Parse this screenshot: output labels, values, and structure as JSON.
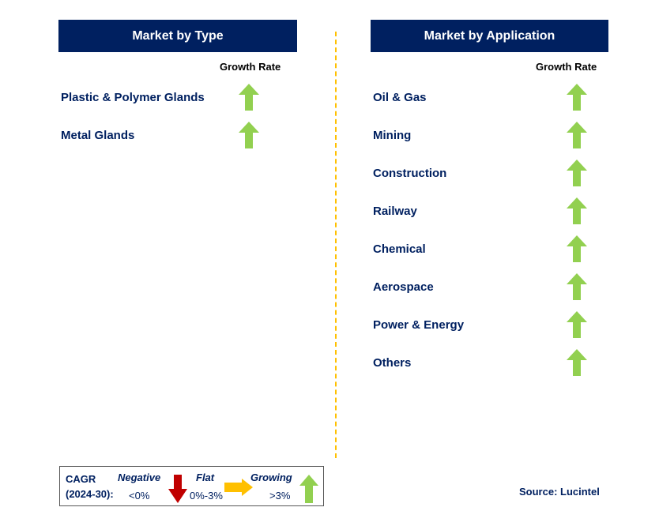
{
  "left": {
    "title": "Market by Type",
    "growth_label": "Growth Rate",
    "items": [
      {
        "label": "Plastic & Polymer Glands",
        "trend": "growing"
      },
      {
        "label": "Metal Glands",
        "trend": "growing"
      }
    ]
  },
  "right": {
    "title": "Market by Application",
    "growth_label": "Growth Rate",
    "items": [
      {
        "label": "Oil & Gas",
        "trend": "growing"
      },
      {
        "label": "Mining",
        "trend": "growing"
      },
      {
        "label": "Construction",
        "trend": "growing"
      },
      {
        "label": "Railway",
        "trend": "growing"
      },
      {
        "label": "Chemical",
        "trend": "growing"
      },
      {
        "label": "Aerospace",
        "trend": "growing"
      },
      {
        "label": "Power & Energy",
        "trend": "growing"
      },
      {
        "label": "Others",
        "trend": "growing"
      }
    ]
  },
  "legend": {
    "cagr": "CAGR",
    "period": "(2024-30):",
    "negative": "Negative",
    "negative_range": "<0%",
    "flat": "Flat",
    "flat_range": "0%-3%",
    "growing": "Growing",
    "growing_range": ">3%"
  },
  "source": "Source: Lucintel",
  "colors": {
    "header": "#002060",
    "growing": "#92D050",
    "flat": "#FFC000",
    "negative": "#C00000",
    "divider": "#FFC000"
  }
}
